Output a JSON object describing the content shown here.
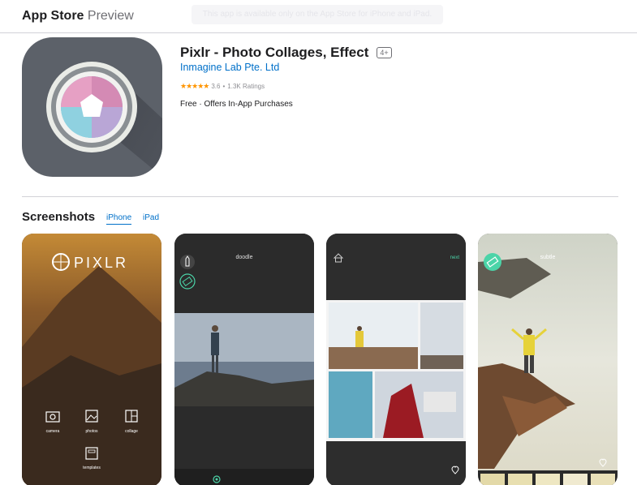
{
  "header": {
    "brand": "App Store",
    "brand_suffix": "Preview",
    "banner": "This app is available only on the App Store for iPhone and iPad."
  },
  "app": {
    "title": "Pixlr - Photo Collages, Effect",
    "age_rating": "4+",
    "developer": "Inmagine Lab Pte. Ltd",
    "rating_stars": "★★★★★",
    "rating_value": "3.6",
    "rating_sep": "•",
    "rating_count": "1.3K Ratings",
    "price": "Free · Offers In-App Purchases"
  },
  "screenshots": {
    "heading": "Screenshots",
    "tabs": [
      "iPhone",
      "iPad"
    ],
    "shot1": {
      "logo": "PIXLR",
      "labels": [
        "camera",
        "photos",
        "collage",
        "templates"
      ]
    },
    "shot2": {
      "title": "doodle"
    },
    "shot3": {
      "next": "next"
    },
    "shot4": {
      "title": "subtle"
    }
  },
  "icons": [
    "camera-icon",
    "photos-icon",
    "collage-icon",
    "templates-icon",
    "home-icon",
    "heart-icon",
    "eraser-icon",
    "pen-icon"
  ]
}
